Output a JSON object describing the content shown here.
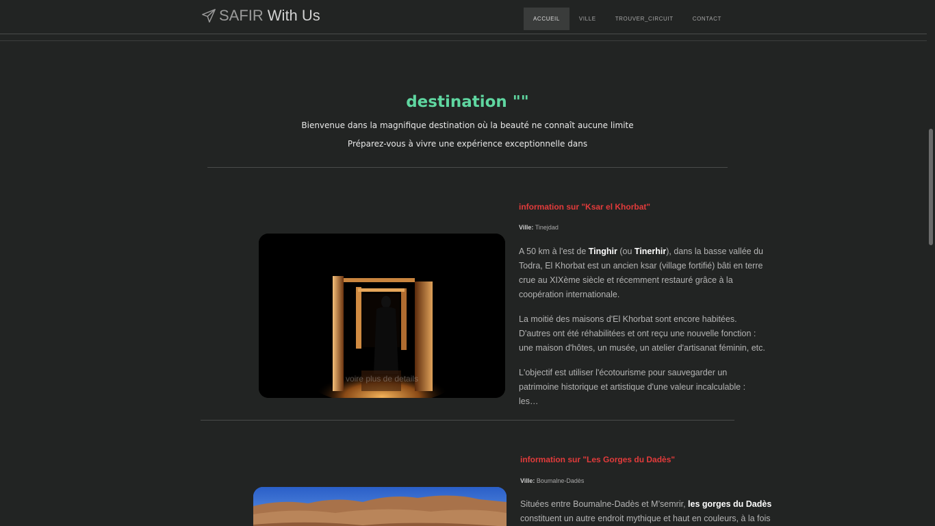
{
  "header": {
    "brand_prefix": "SAFIR",
    "brand_suffix": "With Us",
    "brand_icon": "paper-plane-icon",
    "nav": [
      {
        "label": "ACCUEIL",
        "active": true
      },
      {
        "label": "VILLE",
        "active": false
      },
      {
        "label": "TROUVER_CIRCUIT",
        "active": false
      },
      {
        "label": "CONTACT",
        "active": false
      }
    ]
  },
  "hero": {
    "title": "destination \"\"",
    "line1": "Bienvenue dans la magnifique destination où la beauté ne connaît aucune limite",
    "line2": "Préparez-vous à vivre une expérience exceptionnelle dans"
  },
  "destinations": [
    {
      "title": "information sur \"Ksar el Khorbat\"",
      "ville_label": "Ville:",
      "ville": "Tinejdad",
      "image_caption": "voire plus de details",
      "p1_a": "A 50 km à l'est de ",
      "p1_b1": "Tinghir",
      "p1_c": " (ou ",
      "p1_b2": "Tinerhir",
      "p1_d": "), dans la basse vallée du Todra, El Khorbat est un ancien ksar (village fortifié) bâti en terre crue au XIXème siècle et récemment restauré grâce à la coopération internationale.",
      "p2": "La moitié des maisons d'El Khorbat sont encore habitées. D'autres ont été réhabilitées et ont reçu une nouvelle fonction : une maison d'hôtes, un musée, un atelier d'artisanat féminin, etc.",
      "p3": "L'objectif est utiliser l'écotourisme pour sauvegarder un patrimoine historique et artistique d'une valeur incalculable : les…"
    },
    {
      "title": "information sur \"Les Gorges du Dadès\"",
      "ville_label": "Ville:",
      "ville": "Boumalne-Dadès",
      "p1_a": "Situées entre Boumalne-Dadès et M’semrir, ",
      "p1_b": "les gorges du Dadès",
      "p1_c": " constituent un autre endroit mythique et haut en couleurs, à la fois"
    }
  ],
  "colors": {
    "background": "#222423",
    "accent_green": "#5fd6a0",
    "title_red": "#e33b3b"
  }
}
